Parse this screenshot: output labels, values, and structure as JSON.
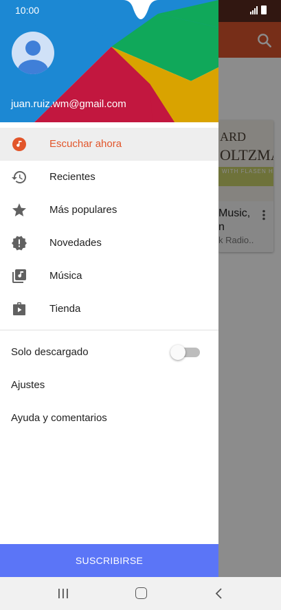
{
  "status_bar": {
    "time": "10:00"
  },
  "drawer": {
    "account_email": "juan.ruiz.wm@gmail.com",
    "items": [
      {
        "label": "Escuchar ahora",
        "icon": "listen-now-icon",
        "active": true
      },
      {
        "label": "Recientes",
        "icon": "history-icon",
        "active": false
      },
      {
        "label": "Más populares",
        "icon": "star-icon",
        "active": false
      },
      {
        "label": "Novedades",
        "icon": "new-releases-icon",
        "active": false
      },
      {
        "label": "Música",
        "icon": "music-library-icon",
        "active": false
      },
      {
        "label": "Tienda",
        "icon": "store-play-icon",
        "active": false
      }
    ],
    "offline_toggle": {
      "label": "Solo descargado",
      "on": false
    },
    "settings_label": "Ajustes",
    "help_label": "Ayuda y comentarios",
    "subscribe_label": "SUSCRIBIRSE"
  },
  "background": {
    "card_title": "Music,",
    "card_title_line2": "n",
    "card_subtitle": "k Radio..",
    "cover_text_top": "ARD",
    "cover_text_main": "OLTZMAN",
    "cover_text_band": "WITH FLASEN HAIR"
  },
  "colors": {
    "accent": "#e2552a",
    "subscribe": "#5b75f7",
    "toolbar": "#d9552d"
  }
}
